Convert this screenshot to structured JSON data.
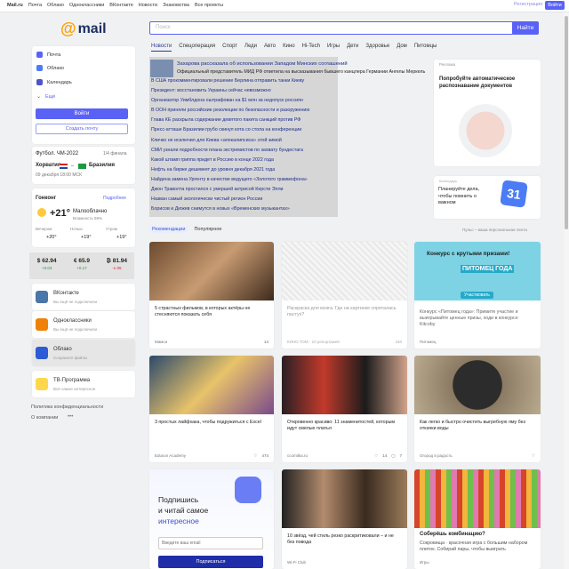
{
  "topbar": {
    "brand": "Mail.ru",
    "links": [
      "Почта",
      "Облако",
      "Одноклассники",
      "ВКонтакте",
      "Новости",
      "Знакомства",
      "Все проекты"
    ],
    "register": "Регистрация",
    "login": "Войти"
  },
  "logo": {
    "text": "mail"
  },
  "sidebar": {
    "items": [
      {
        "label": "Почта",
        "color": "#5a62f6"
      },
      {
        "label": "Облако",
        "color": "#4b7cf6"
      },
      {
        "label": "Календарь",
        "color": "#4d54c8"
      },
      {
        "label": "Ещё",
        "color": "#555"
      }
    ],
    "login_btn": "Войти",
    "create_btn": "Создать почту"
  },
  "football": {
    "title": "Футбол. ЧМ-2022",
    "stage": "1/4 финала",
    "team1": "Хорватия",
    "team2": "Бразилия",
    "date": "09 декабря 18:00 МСК"
  },
  "weather": {
    "city": "Гонконг",
    "forecast_link": "Подробнее",
    "temp": "+21°",
    "desc": "Малооблачно",
    "humidity": "Влажность 58%",
    "parts": [
      {
        "label": "Вечером",
        "temp": "+20°"
      },
      {
        "label": "Ночью",
        "temp": "+19°"
      },
      {
        "label": "Утром",
        "temp": "+19°"
      }
    ]
  },
  "rates": [
    {
      "sym": "$",
      "value": "62.94",
      "delta": "+0.03"
    },
    {
      "sym": "€",
      "value": "65.9",
      "delta": "+0.17"
    },
    {
      "sym": "₿",
      "value": "81.94",
      "delta": "-1.05"
    }
  ],
  "services": [
    {
      "title": "ВКонтакте",
      "sub": "Вы ещё не подключили",
      "color": "#4a76a8"
    },
    {
      "title": "Одноклассники",
      "sub": "Вы ещё не подключили",
      "color": "#ee8208"
    },
    {
      "title": "Облако",
      "sub": "Сохраните файлы",
      "color": "#2b5bd7"
    },
    {
      "title": "ТВ-Программа",
      "sub": "Всё самое интересное",
      "color": "#ffd74d"
    }
  ],
  "footer": {
    "privacy": "Политика конфиденциальности",
    "about": "О компании"
  },
  "search": {
    "placeholder": "Поиск",
    "button": "Найти"
  },
  "tabs": [
    "Новости",
    "Спецоперация",
    "Спорт",
    "Леди",
    "Авто",
    "Кино",
    "Hi-Tech",
    "Игры",
    "Дети",
    "Здоровье",
    "Дом",
    "Питомцы"
  ],
  "news": {
    "top_title": "Захарова рассказала об использовании Западом Минских соглашений",
    "top_sub": "Официальный представитель МИД РФ ответила на высказывания бывшего канцлера Германии Ангелы Меркель",
    "items": [
      "В США прокомментировали решение Берлина отправить танки Киеву",
      "Президент: восстановить Украины сейчас невозможно",
      "Организатор Уимблдона оштрафован на $1 млн за недопуск россиян",
      "В ООН приняли российские резолюции по безопасности и разоружению",
      "Глава КЕ раскрыла содержание девятого пакета санкций против РФ",
      "Пресс-атташе Бразилии грубо скинул кота со стола на конференции",
      "Кличко не исключил для Киева «апокалипсиса» этой зимой",
      "СМИ узнали подробности плана экстремистов по захвату бундестага",
      "Какой штамп гриппа придет в Россию в конце 2022 года",
      "Нефть на бирже дешевеет до уровня декабря 2021 года",
      "Найдена замена Ургенту в качестве ведущего «Золотого граммофона»",
      "Джон Траволта простился с умершей актрисой Керсти Элли",
      "Назван самый экологически чистый регион России",
      "Борисов и Дюжев снимутся в новых «Временских музыкантах»"
    ]
  },
  "ad_top": {
    "label": "Реклама",
    "text": "Попробуйте автоматическое распознавание документов"
  },
  "ad_cal": {
    "label": "Календарь",
    "text": "Планируйте дела, чтобы помнить о важном",
    "day": "31"
  },
  "rec": {
    "tab_active": "Рекомендации",
    "tab_other": "Популярное",
    "note": "Пульс – ваша персональная лента"
  },
  "cards": [
    {
      "caption": "5 страстных фильмов, в которых актёры не стесняются показать себя",
      "source": "Мамси",
      "count": "14"
    },
    {
      "caption": "Раскраска для мозга. Где на картинке спряталась пастух?",
      "source": "КИНО ТОМ · 10 репортажей",
      "count": "240"
    },
    {
      "caption": "Конкурс «Питомец года»: Примите участие и выигрывайте ценные призы, ходи в конкурсе Kitcoby",
      "source": "Питомец",
      "title": "Конкурс с крутыми призами!",
      "overlay": "ПИТОМЕЦ ГОДА",
      "overlay_btn": "Участвовать"
    },
    {
      "caption": "3 простых лайфхака, чтобы подружиться с Excel",
      "source": "Eduson Academy",
      "count": "474"
    },
    {
      "caption": "Откровенно красиво: 11 знаменитостей, которым идут смелые платья",
      "source": "ccomitka.ru",
      "count": "14",
      "count2": "7"
    },
    {
      "caption": "Как легко и быстро очистить выгребную яму без откачки воды",
      "source": "Огород в радость"
    },
    {
      "title": "Подпишись",
      "title2": "и читай самое",
      "title3": "интересное",
      "placeholder": "Введите ваш email",
      "button": "Подписаться"
    },
    {
      "caption": "10 звёзд, чей стиль резко раскритиковали – и не без повода",
      "source": "Wi-Fi Club"
    },
    {
      "caption": "Соберёшь комбинацию?",
      "sub": "Сокровища · красочная игра с большим набором плиток. Собирай пары, чтобы выиграть",
      "source": "Игры"
    }
  ]
}
